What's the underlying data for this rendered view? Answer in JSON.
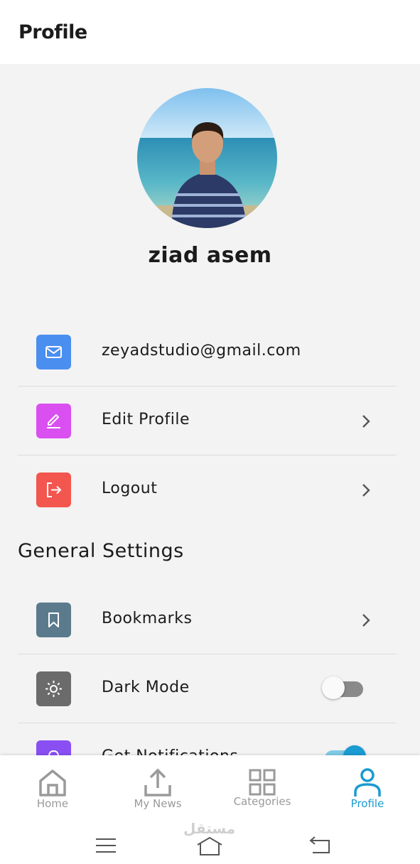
{
  "appbar": {
    "title": "Profile"
  },
  "profile": {
    "name": "ziad asem"
  },
  "account_items": [
    {
      "label": "zeyadstudio@gmail.com",
      "icon": "mail-icon",
      "color": "#4a8ef0"
    },
    {
      "label": "Edit Profile",
      "icon": "edit-icon",
      "color": "#d94ff0"
    },
    {
      "label": "Logout",
      "icon": "logout-icon",
      "color": "#f2564f"
    }
  ],
  "general_settings": {
    "title": "General Settings",
    "items": [
      {
        "label": "Bookmarks",
        "icon": "bookmark-icon",
        "color": "#5b7b8d"
      },
      {
        "label": "Dark Mode",
        "icon": "sun-icon",
        "color": "#6b6b6b",
        "toggle_on": false
      },
      {
        "label": "Get Notifications",
        "icon": "bell-icon",
        "color": "#8a4ff2",
        "toggle_on": true
      }
    ]
  },
  "bottom_nav": {
    "items": [
      {
        "label": "Home",
        "icon": "home-icon",
        "active": false
      },
      {
        "label": "My News",
        "icon": "upload-icon",
        "active": false
      },
      {
        "label": "Categories",
        "icon": "grid-icon",
        "active": false
      },
      {
        "label": "Profile",
        "icon": "person-icon",
        "active": true
      }
    ],
    "active_color": "#1a9bd1",
    "inactive_color": "#9a9a9a"
  },
  "system_nav": {
    "icons": [
      "menu-icon",
      "home-outline-icon",
      "back-icon"
    ]
  },
  "watermark": {
    "text": "مستقل"
  }
}
